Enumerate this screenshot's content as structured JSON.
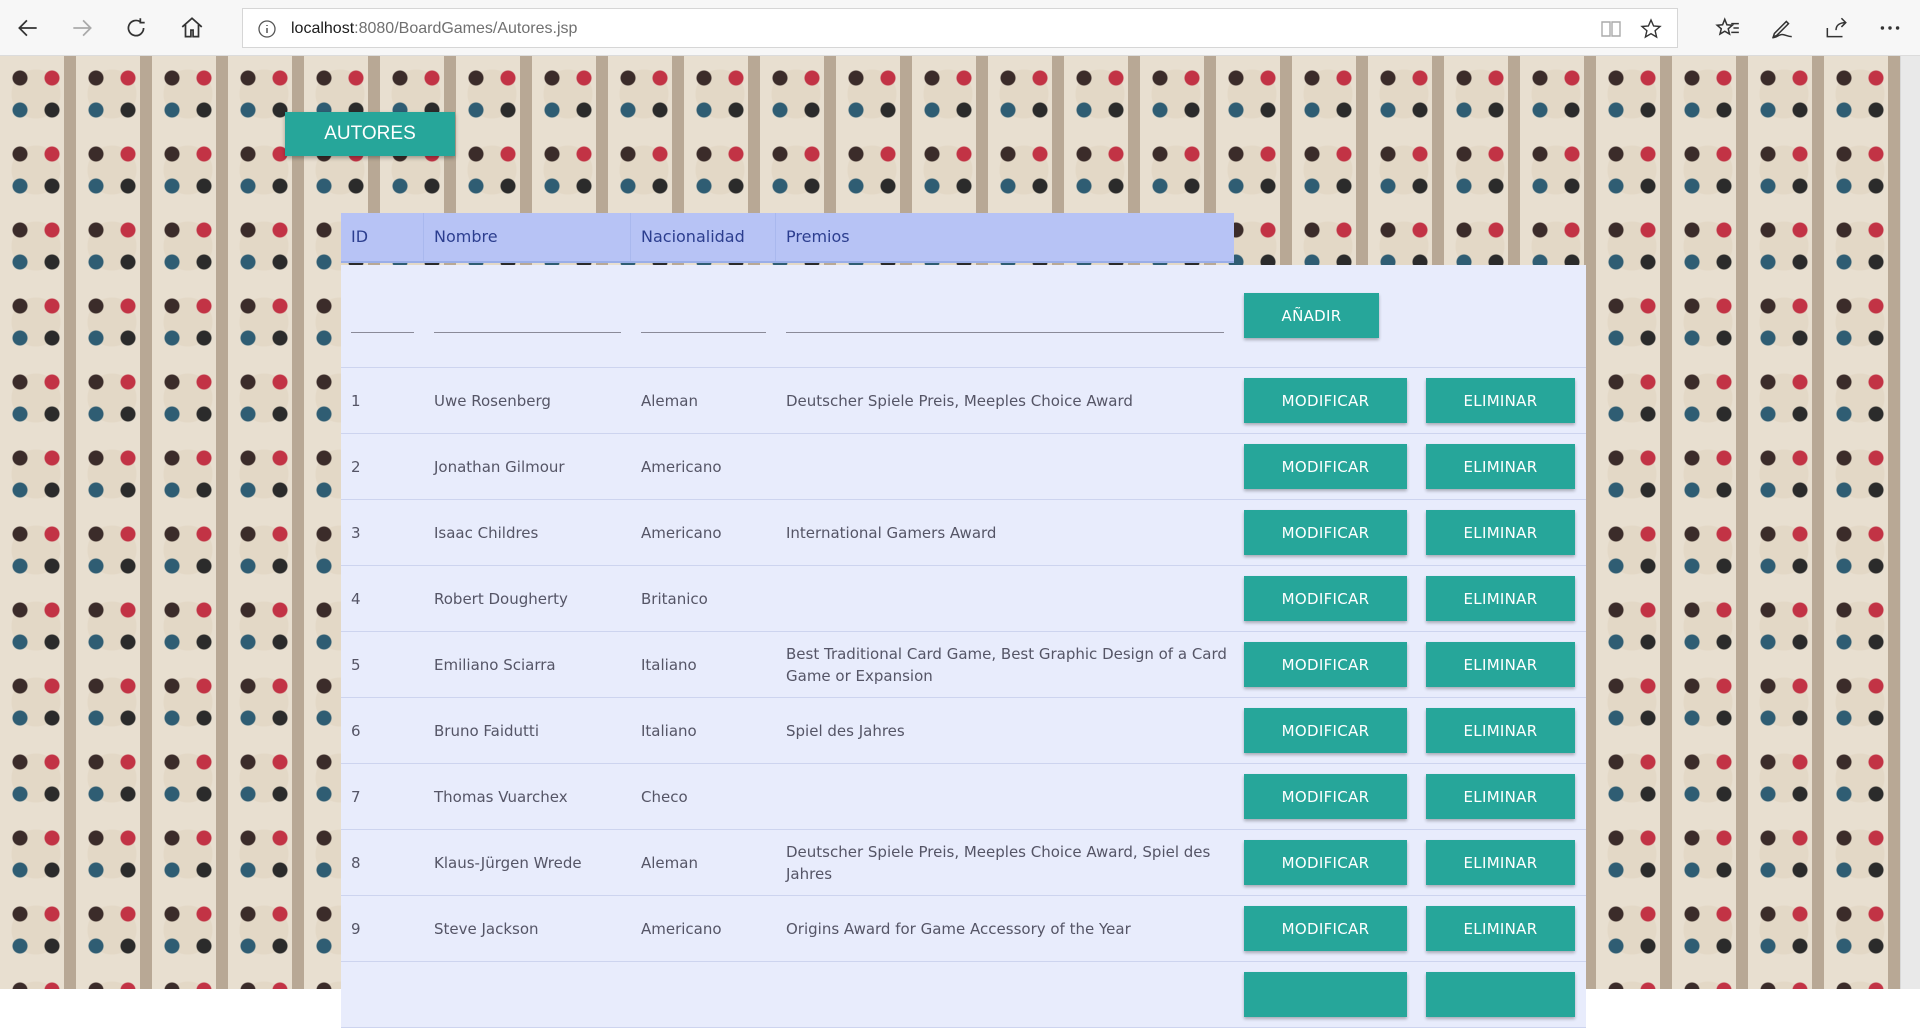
{
  "browser": {
    "url_host": "localhost",
    "url_rest": ":8080/BoardGames/Autores.jsp"
  },
  "page": {
    "title_button": "AUTORES",
    "add_button": "AÑADIR",
    "modify_label": "MODIFICAR",
    "delete_label": "ELIMINAR"
  },
  "table": {
    "headers": [
      "ID",
      "Nombre",
      "Nacionalidad",
      "Premios"
    ],
    "rows": [
      {
        "id": "1",
        "nombre": "Uwe Rosenberg",
        "nacionalidad": "Aleman",
        "premios": "Deutscher Spiele Preis, Meeples Choice Award"
      },
      {
        "id": "2",
        "nombre": "Jonathan Gilmour",
        "nacionalidad": "Americano",
        "premios": ""
      },
      {
        "id": "3",
        "nombre": "Isaac Childres",
        "nacionalidad": "Americano",
        "premios": "International Gamers Award"
      },
      {
        "id": "4",
        "nombre": "Robert Dougherty",
        "nacionalidad": "Britanico",
        "premios": ""
      },
      {
        "id": "5",
        "nombre": "Emiliano Sciarra",
        "nacionalidad": "Italiano",
        "premios": "Best Traditional Card Game, Best Graphic Design of a Card Game or Expansion"
      },
      {
        "id": "6",
        "nombre": "Bruno Faidutti",
        "nacionalidad": "Italiano",
        "premios": "Spiel des Jahres"
      },
      {
        "id": "7",
        "nombre": "Thomas Vuarchex",
        "nacionalidad": "Checo",
        "premios": ""
      },
      {
        "id": "8",
        "nombre": "Klaus-Jürgen Wrede",
        "nacionalidad": "Aleman",
        "premios": "Deutscher Spiele Preis, Meeples Choice Award, Spiel des Jahres"
      },
      {
        "id": "9",
        "nombre": "Steve Jackson",
        "nacionalidad": "Americano",
        "premios": "Origins Award for Game Accessory of the Year"
      }
    ]
  },
  "colors": {
    "accent": "#26a69a",
    "header_bg": "#b7c3f5",
    "row_bg": "#e8ecfc"
  }
}
